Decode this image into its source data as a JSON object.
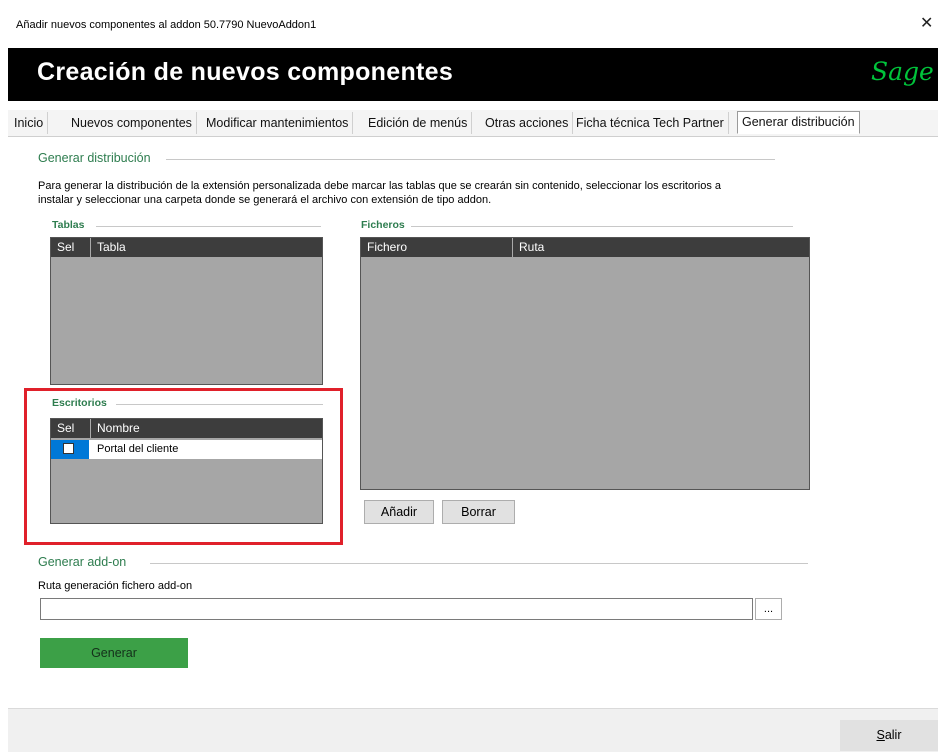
{
  "window": {
    "title": "Añadir nuevos componentes al addon 50.7790 NuevoAddon1",
    "close_glyph": "✕"
  },
  "header": {
    "title": "Creación de nuevos componentes",
    "logo_text": "Sage",
    "background_color": "#000000",
    "logo_color": "#00c43b"
  },
  "tabs": [
    {
      "label": "Inicio",
      "active": false
    },
    {
      "label": "Nuevos componentes",
      "active": false
    },
    {
      "label": "Modificar mantenimientos",
      "active": false
    },
    {
      "label": "Edición de menús",
      "active": false
    },
    {
      "label": "Otras acciones",
      "active": false
    },
    {
      "label": "Ficha técnica Tech Partner",
      "active": false
    },
    {
      "label": "Generar distribución",
      "active": true
    }
  ],
  "distribucion": {
    "section_title": "Generar distribución",
    "description_line1": "Para generar la distribución de la extensión personalizada debe marcar las tablas que se crearán sin contenido, seleccionar los escritorios a",
    "description_line2": "instalar y seleccionar una carpeta donde se generará el archivo con extensión de tipo addon.",
    "tablas": {
      "title": "Tablas",
      "columns": [
        "Sel",
        "Tabla"
      ],
      "rows": []
    },
    "escritorios": {
      "title": "Escritorios",
      "columns": [
        "Sel",
        "Nombre"
      ],
      "rows": [
        {
          "sel": false,
          "nombre": "Portal del cliente"
        }
      ]
    },
    "ficheros": {
      "title": "Ficheros",
      "columns": [
        "Fichero",
        "Ruta"
      ],
      "rows": [],
      "add_label": "Añadir",
      "delete_label": "Borrar"
    }
  },
  "addon": {
    "section_title": "Generar add-on",
    "path_label": "Ruta generación fichero add-on",
    "path_value": "",
    "browse_label": "...",
    "generate_label": "Generar",
    "generate_color": "#3ca047"
  },
  "footer": {
    "exit_label": "Salir"
  },
  "highlight_color": "#e0202a"
}
